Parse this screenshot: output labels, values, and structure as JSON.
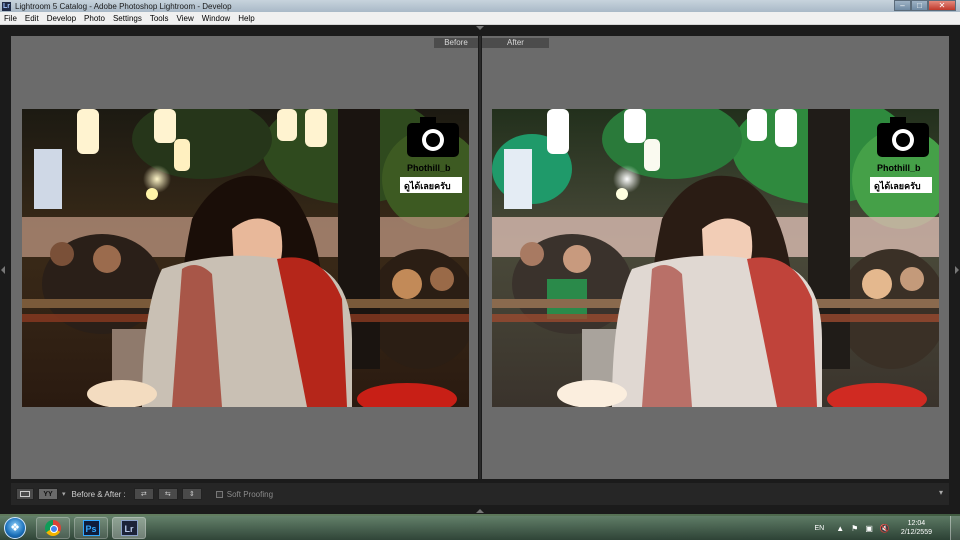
{
  "window": {
    "title": "Lightroom 5 Catalog - Adobe Photoshop Lightroom - Develop",
    "app_icon": "Lr",
    "minimize_glyph": "–",
    "maximize_glyph": "□",
    "close_glyph": "✕"
  },
  "menu": [
    "File",
    "Edit",
    "Develop",
    "Photo",
    "Settings",
    "Tools",
    "View",
    "Window",
    "Help"
  ],
  "view": {
    "before_label": "Before",
    "after_label": "After"
  },
  "photo": {
    "watermark_line1": "Phothill_b",
    "watermark_line2": "ดูได้เลยครับ"
  },
  "toolbar": {
    "yy_label": "YY",
    "caret": "▾",
    "mode_label": "Before & After :",
    "swap1_glyph": "⇄",
    "swap2_glyph": "⇆",
    "swap3_glyph": "⇕",
    "soft_proofing_label": "Soft Proofing",
    "soft_proofing_checked": false,
    "more_glyph": "▾"
  },
  "taskbar": {
    "ps_label": "Ps",
    "lr_label": "Lr",
    "language": "EN",
    "tray_icons": [
      "▲",
      "⚑",
      "▣",
      "🔇"
    ],
    "time": "12:04",
    "date": "2/12/2559"
  },
  "colors": {
    "accent_blue": "#31a8ff",
    "panel_gray": "#6b6b6b",
    "toolbar_dark": "#262626"
  }
}
